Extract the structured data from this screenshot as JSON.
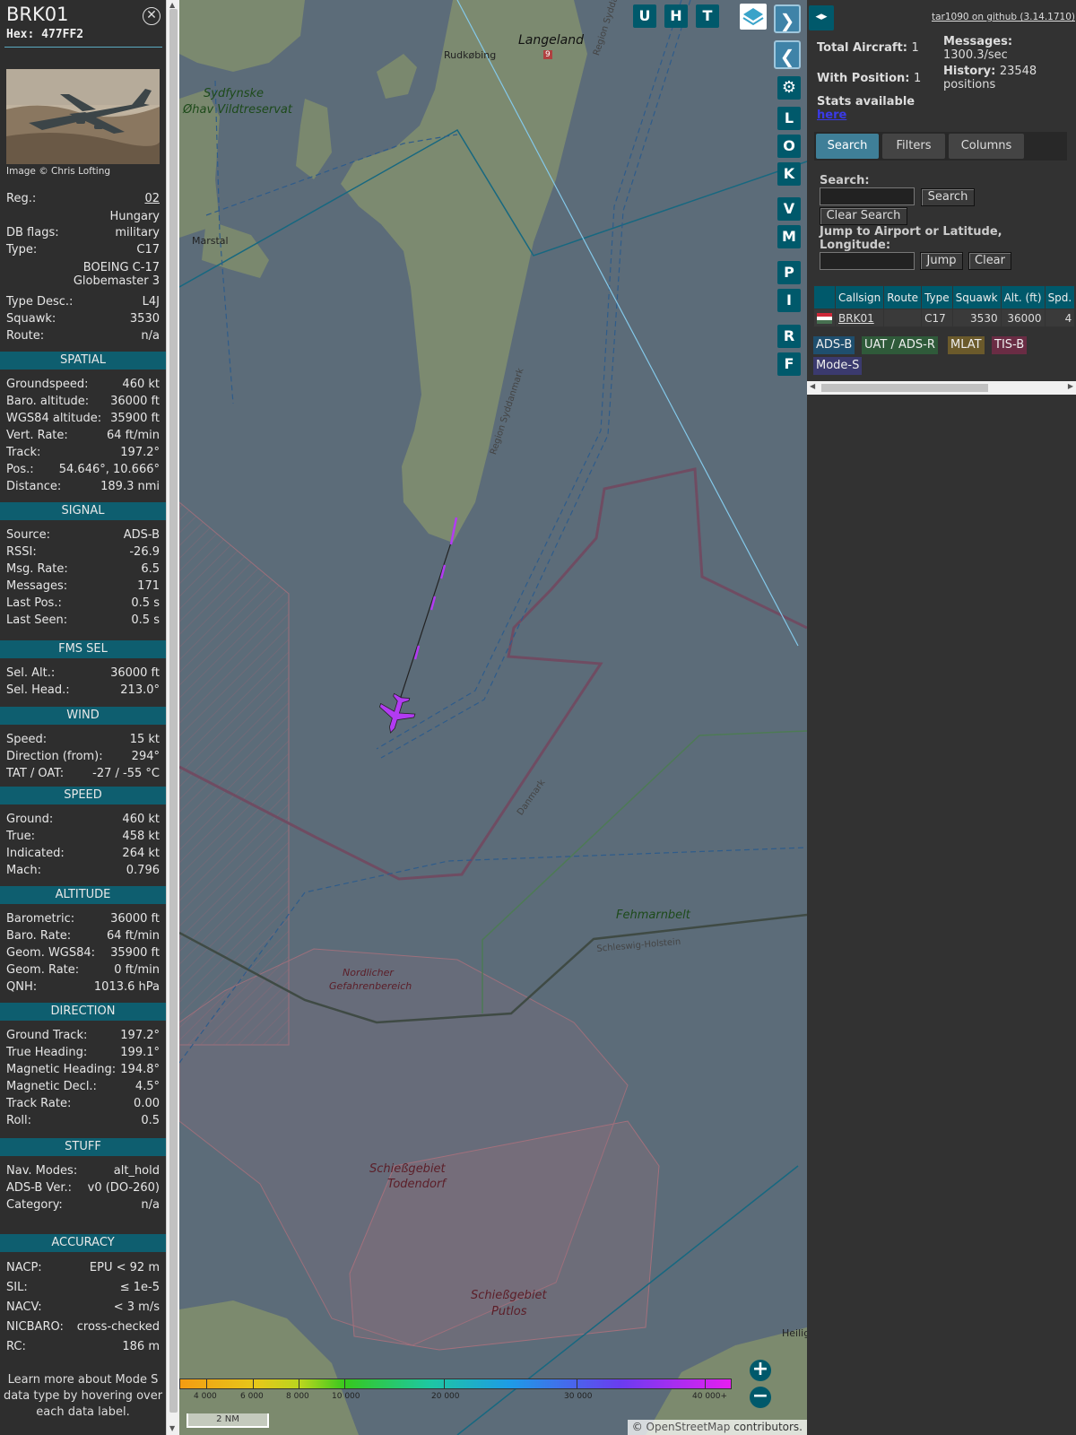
{
  "info": {
    "callsign": "BRK01",
    "hex_label": "Hex:",
    "hex": "477FF2",
    "image_credit": "Image © Chris Lofting",
    "reg_label": "Reg.:",
    "reg": "02",
    "country": "Hungary",
    "dbflags_label": "DB flags:",
    "dbflags": "military",
    "type_label": "Type:",
    "type": "C17",
    "type_name_1": "BOEING C-17",
    "type_name_2": "Globemaster 3",
    "typedesc_label": "Type Desc.:",
    "typedesc": "L4J",
    "squawk_label": "Squawk:",
    "squawk": "3530",
    "route_label": "Route:",
    "route": "n/a",
    "sections": {
      "spatial": "SPATIAL",
      "signal": "SIGNAL",
      "fms": "FMS SEL",
      "wind": "WIND",
      "speed": "SPEED",
      "altitude": "ALTITUDE",
      "direction": "DIRECTION",
      "stuff": "STUFF",
      "accuracy": "ACCURACY"
    },
    "spatial": [
      {
        "k": "Groundspeed:",
        "v": "460 kt"
      },
      {
        "k": "Baro. altitude:",
        "v": "36000 ft"
      },
      {
        "k": "WGS84 altitude:",
        "v": "35900 ft"
      },
      {
        "k": "Vert. Rate:",
        "v": "64 ft/min"
      },
      {
        "k": "Track:",
        "v": "197.2°"
      },
      {
        "k": "Pos.:",
        "v": "54.646°, 10.666°"
      },
      {
        "k": "Distance:",
        "v": "189.3 nmi"
      }
    ],
    "signal": [
      {
        "k": "Source:",
        "v": "ADS-B"
      },
      {
        "k": "RSSI:",
        "v": "-26.9"
      },
      {
        "k": "Msg. Rate:",
        "v": "6.5"
      },
      {
        "k": "Messages:",
        "v": "171"
      },
      {
        "k": "Last Pos.:",
        "v": "0.5 s"
      },
      {
        "k": "Last Seen:",
        "v": "0.5 s"
      }
    ],
    "fms": [
      {
        "k": "Sel. Alt.:",
        "v": "36000 ft"
      },
      {
        "k": "Sel. Head.:",
        "v": "213.0°"
      }
    ],
    "wind": [
      {
        "k": "Speed:",
        "v": "15 kt"
      },
      {
        "k": "Direction (from):",
        "v": "294°"
      },
      {
        "k": "TAT / OAT:",
        "v": "-27 / -55 °C"
      }
    ],
    "speed": [
      {
        "k": "Ground:",
        "v": "460 kt"
      },
      {
        "k": "True:",
        "v": "458 kt"
      },
      {
        "k": "Indicated:",
        "v": "264 kt"
      },
      {
        "k": "Mach:",
        "v": "0.796"
      }
    ],
    "altitude": [
      {
        "k": "Barometric:",
        "v": "36000 ft"
      },
      {
        "k": "Baro. Rate:",
        "v": "64 ft/min"
      },
      {
        "k": "Geom. WGS84:",
        "v": "35900 ft"
      },
      {
        "k": "Geom. Rate:",
        "v": "0 ft/min"
      },
      {
        "k": "QNH:",
        "v": "1013.6 hPa"
      }
    ],
    "direction": [
      {
        "k": "Ground Track:",
        "v": "197.2°"
      },
      {
        "k": "True Heading:",
        "v": "199.1°"
      },
      {
        "k": "Magnetic Heading:",
        "v": "194.8°"
      },
      {
        "k": "Magnetic Decl.:",
        "v": "4.5°"
      },
      {
        "k": "Track Rate:",
        "v": "0.00"
      },
      {
        "k": "Roll:",
        "v": "0.5"
      }
    ],
    "stuff": [
      {
        "k": "Nav. Modes:",
        "v": "alt_hold"
      },
      {
        "k": "ADS-B Ver.:",
        "v": "v0 (DO-260)"
      },
      {
        "k": "Category:",
        "v": "n/a"
      }
    ],
    "accuracy": [
      {
        "k": "NACP:",
        "v": "EPU < 92 m"
      },
      {
        "k": "SIL:",
        "v": "≤ 1e-5"
      },
      {
        "k": "NACV:",
        "v": "< 3 m/s"
      },
      {
        "k": "NICBARO:",
        "v": "cross-checked"
      },
      {
        "k": "RC:",
        "v": "186 m"
      }
    ],
    "learn_more": "Learn more about Mode S data type by hovering over each data label."
  },
  "map": {
    "labels": {
      "langeland": "Langeland",
      "rudkobing": "Rudkøbing",
      "sydfynske_1": "Sydfynske",
      "sydfynske_2": "Øhav Vildtreservat",
      "marstal": "Marstal",
      "region_top": "Region Syddanm",
      "region_mid": "Region Syddanmark",
      "danmark": "Danmark",
      "fehmarnbelt": "Fehmarnbelt",
      "schleswig": "Schleswig-Holstein",
      "nordlicher_1": "Nordlicher",
      "nordlicher_2": "Gefahrenbereich",
      "todendorf_1": "Schießgebiet",
      "todendorf_2": "Todendorf",
      "putlos_1": "Schießgebiet",
      "putlos_2": "Putlos",
      "heilig": "Heilig",
      "road9": "9"
    },
    "top_buttons": [
      "U",
      "H",
      "T"
    ],
    "side_buttons": [
      "L",
      "O",
      "K",
      "V",
      "M",
      "P",
      "I",
      "R",
      "F"
    ],
    "legend_ticks": [
      "4 000",
      "6 000",
      "8 000",
      "10 000",
      "20 000",
      "30 000",
      "40 000+"
    ],
    "scale": "2 NM",
    "attribution_prefix": "©",
    "attribution_link": "OpenStreetMap",
    "attribution_suffix": "contributors.",
    "aircraft_color": "#b23bf2"
  },
  "sidebar": {
    "toggle_icon": "◂▸",
    "github_link": "tar1090 on github (3.14.1710)",
    "total_label": "Total Aircraft:",
    "total": "1",
    "position_label": "With Position:",
    "position": "1",
    "messages_label": "Messages:",
    "messages": "1300.3/sec",
    "history_label": "History:",
    "history": "23548",
    "history_unit": "positions",
    "stats_label": "Stats available",
    "stats_link": "here",
    "tabs": [
      "Search",
      "Filters",
      "Columns"
    ],
    "search_label": "Search:",
    "search_button": "Search",
    "clear_search_button": "Clear Search",
    "jump_label": "Jump to Airport or Latitude, Longitude:",
    "jump_button": "Jump",
    "clear_button": "Clear",
    "table": {
      "headers": [
        "Callsign",
        "Route",
        "Type",
        "Squawk",
        "Alt. (ft)",
        "Spd."
      ],
      "row": {
        "callsign": "BRK01",
        "route": "",
        "type": "C17",
        "squawk": "3530",
        "alt": "36000",
        "spd": "4"
      }
    },
    "source_tags": [
      {
        "label": "ADS-B",
        "color": "#1f4f6e"
      },
      {
        "label": "UAT / ADS-R",
        "color": "#2f5a3a"
      },
      {
        "label": "MLAT",
        "color": "#6b5a2b"
      },
      {
        "label": "TIS-B",
        "color": "#6a2c44"
      },
      {
        "label": "Mode-S",
        "color": "#3b3a6e"
      }
    ]
  }
}
